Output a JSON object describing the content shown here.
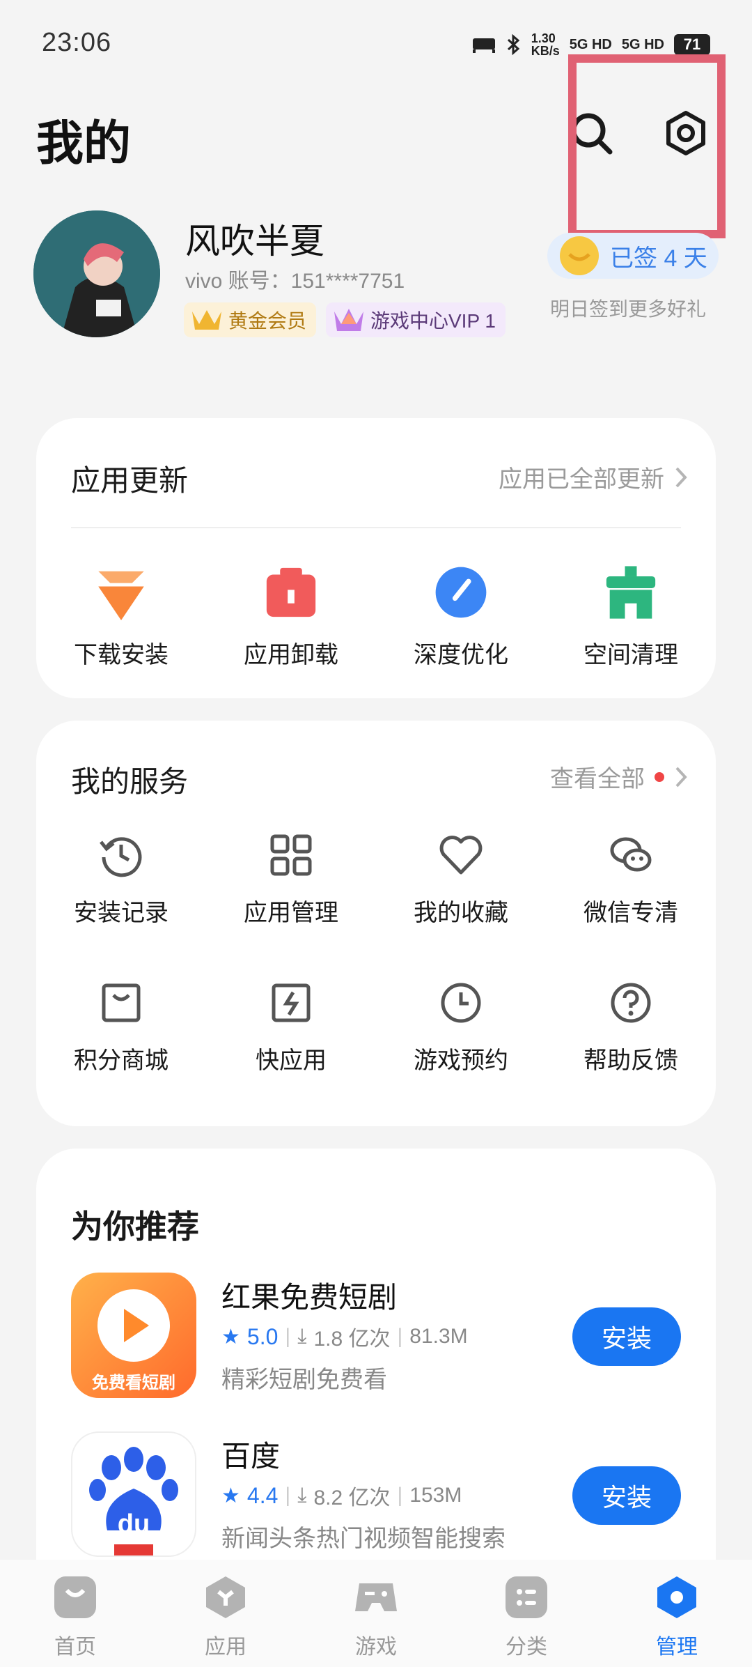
{
  "status": {
    "time": "23:06",
    "net_speed": "1.30\nKB/s",
    "sig1": "5G HD",
    "sig2": "5G HD",
    "battery": "71"
  },
  "header": {
    "title": "我的"
  },
  "profile": {
    "name": "风吹半夏",
    "account": "vivo 账号：151****7751",
    "badge_gold": "黄金会员",
    "badge_vip": "游戏中心VIP 1",
    "signin": "已签 4 天",
    "signin_sub": "明日签到更多好礼"
  },
  "updates": {
    "title": "应用更新",
    "status": "应用已全部更新",
    "items": [
      {
        "label": "下载安装",
        "color": "#f9863a"
      },
      {
        "label": "应用卸载",
        "color": "#f15b5b"
      },
      {
        "label": "深度优化",
        "color": "#3c86f5"
      },
      {
        "label": "空间清理",
        "color": "#2db67f"
      }
    ]
  },
  "services": {
    "title": "我的服务",
    "view_all": "查看全部",
    "items": [
      {
        "label": "安装记录",
        "icon": "history-icon"
      },
      {
        "label": "应用管理",
        "icon": "grid-icon"
      },
      {
        "label": "我的收藏",
        "icon": "heart-icon"
      },
      {
        "label": "微信专清",
        "icon": "wechat-icon"
      },
      {
        "label": "积分商城",
        "icon": "shopping-bag-icon"
      },
      {
        "label": "快应用",
        "icon": "quick-app-icon"
      },
      {
        "label": "游戏预约",
        "icon": "clock-icon"
      },
      {
        "label": "帮助反馈",
        "icon": "help-icon"
      }
    ]
  },
  "recommend": {
    "title": "为你推荐",
    "apps": [
      {
        "name": "红果免费短剧",
        "score": "5.0",
        "downloads": "1.8 亿次",
        "size": "81.3M",
        "desc": "精彩短剧免费看",
        "icon_text": "免费看短剧",
        "action": "安装"
      },
      {
        "name": "百度",
        "score": "4.4",
        "downloads": "8.2 亿次",
        "size": "153M",
        "desc": "新闻头条热门视频智能搜索",
        "icon_text": "du",
        "action": "安装"
      }
    ]
  },
  "nav": [
    {
      "label": "首页"
    },
    {
      "label": "应用"
    },
    {
      "label": "游戏"
    },
    {
      "label": "分类"
    },
    {
      "label": "管理"
    }
  ],
  "colors": {
    "accent": "#1a76f2",
    "highlight": "#e06173"
  }
}
